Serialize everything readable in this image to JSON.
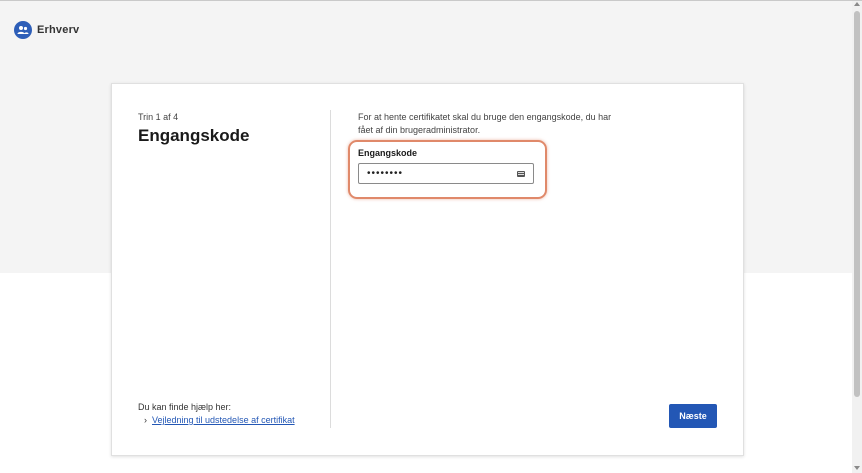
{
  "header": {
    "brand_name": "Erhverv",
    "logo_icon": "people-group-icon",
    "brand_color": "#2d5eb8"
  },
  "wizard": {
    "step_text": "Trin 1 af 4",
    "title": "Engangskode",
    "help_label": "Du kan finde hjælp her:",
    "help_link": "Vejledning til udstedelse af certifikat",
    "intro_text": "For at hente certifikatet skal du bruge den engangskode, du har fået af din brugeradministrator.",
    "field": {
      "label": "Engangskode",
      "value": "••••••••",
      "icon": "password-manager-icon"
    },
    "next_button": "Næste",
    "accent_color": "#2357b5",
    "highlight_color": "#e0896a"
  }
}
